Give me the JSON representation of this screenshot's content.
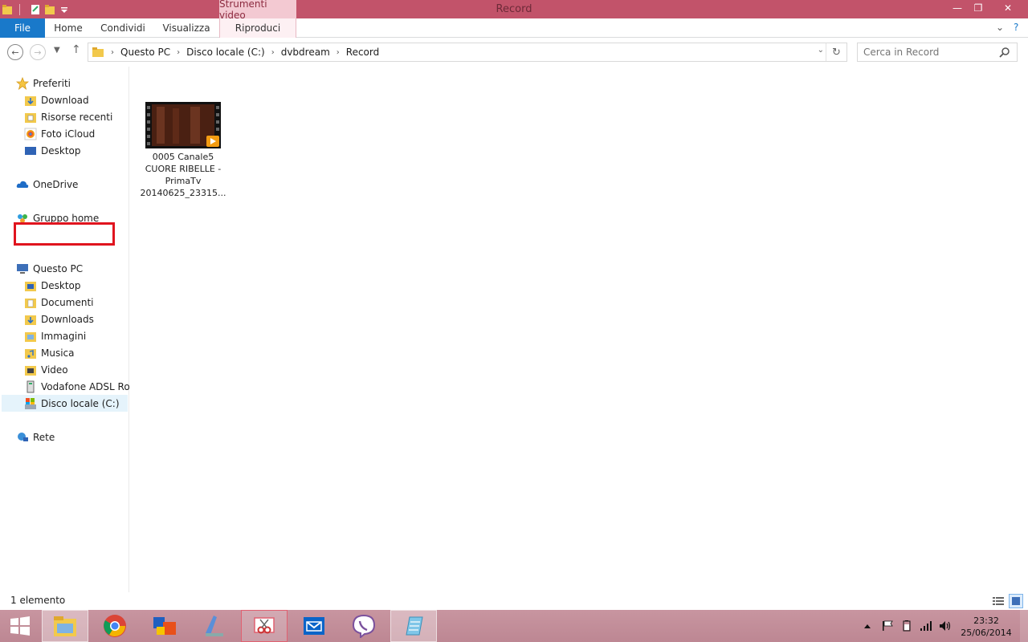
{
  "window": {
    "title": "Record",
    "contextual_tab_header": "Strumenti video",
    "minimize": "—",
    "maximize": "❐",
    "close": "✕"
  },
  "ribbon": {
    "file": "File",
    "tabs": [
      "Home",
      "Condividi",
      "Visualizza",
      "Riproduci"
    ],
    "expand_glyph": "⌄",
    "help_glyph": "?"
  },
  "address": {
    "breadcrumbs": [
      "Questo PC",
      "Disco locale (C:)",
      "dvbdream",
      "Record"
    ],
    "search_placeholder": "Cerca in Record"
  },
  "nav": {
    "favorites": {
      "label": "Preferiti",
      "items": [
        "Download",
        "Risorse recenti",
        "Foto iCloud",
        "Desktop"
      ]
    },
    "onedrive": "OneDrive",
    "homegroup": "Gruppo home",
    "thispc": {
      "label": "Questo PC",
      "items": [
        "Desktop",
        "Documenti",
        "Downloads",
        "Immagini",
        "Musica",
        "Video",
        "Vodafone ADSL Rout",
        "Disco locale (C:)"
      ]
    },
    "network": "Rete"
  },
  "files": [
    {
      "name": "0005 Canale5 CUORE RIBELLE - PrimaTv 20140625_23315...",
      "name_lines": [
        "0005 Canale5",
        "CUORE RIBELLE -",
        "PrimaTv",
        "20140625_23315..."
      ],
      "type": "video"
    }
  ],
  "status": {
    "count": "1 elemento"
  },
  "taskbar": {
    "apps": [
      "start-icon",
      "file-explorer-icon",
      "chrome-icon",
      "media-app-icon",
      "scanner-icon",
      "snipping-tool-icon",
      "mail-icon",
      "viber-icon",
      "notepad-icon"
    ],
    "time": "23:32",
    "date": "25/06/2014"
  },
  "colors": {
    "titlebar": "#c2536a",
    "file_tab": "#1979ca",
    "selection_box": "#e0141e"
  }
}
